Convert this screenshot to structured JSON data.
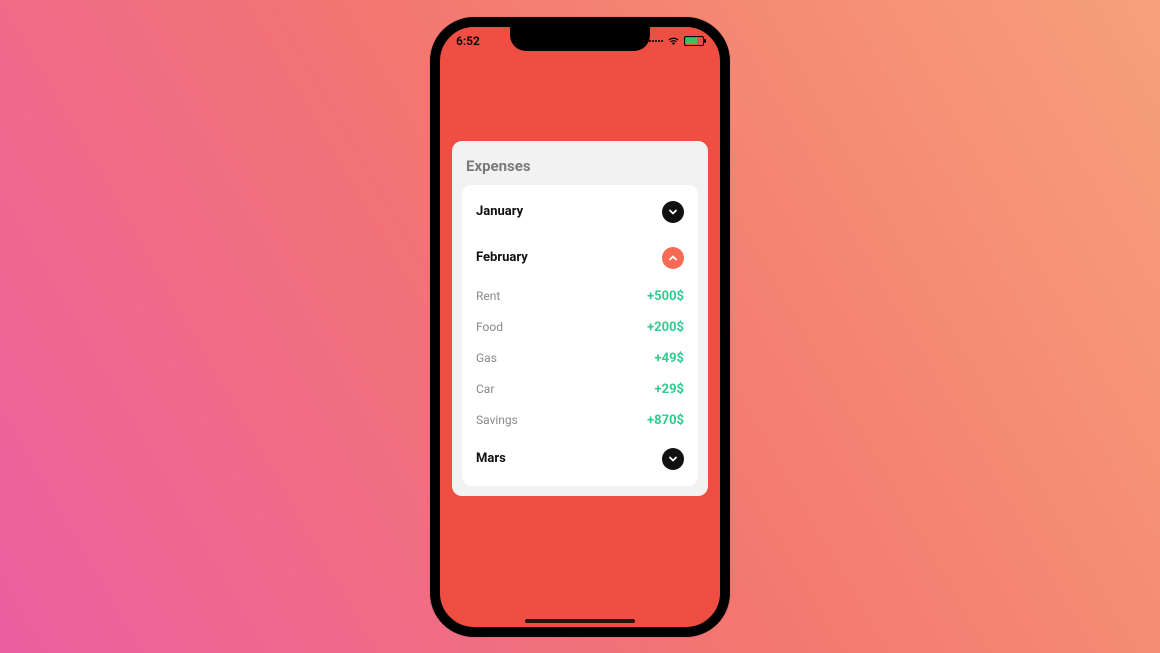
{
  "status": {
    "time": "6:52"
  },
  "card": {
    "title": "Expenses"
  },
  "months": [
    {
      "name": "January",
      "expanded": false,
      "items": []
    },
    {
      "name": "February",
      "expanded": true,
      "items": [
        {
          "label": "Rent",
          "amount": "+500$"
        },
        {
          "label": "Food",
          "amount": "+200$"
        },
        {
          "label": "Gas",
          "amount": "+49$"
        },
        {
          "label": "Car",
          "amount": "+29$"
        },
        {
          "label": "Savings",
          "amount": "+870$"
        }
      ]
    },
    {
      "name": "Mars",
      "expanded": false,
      "items": []
    }
  ]
}
